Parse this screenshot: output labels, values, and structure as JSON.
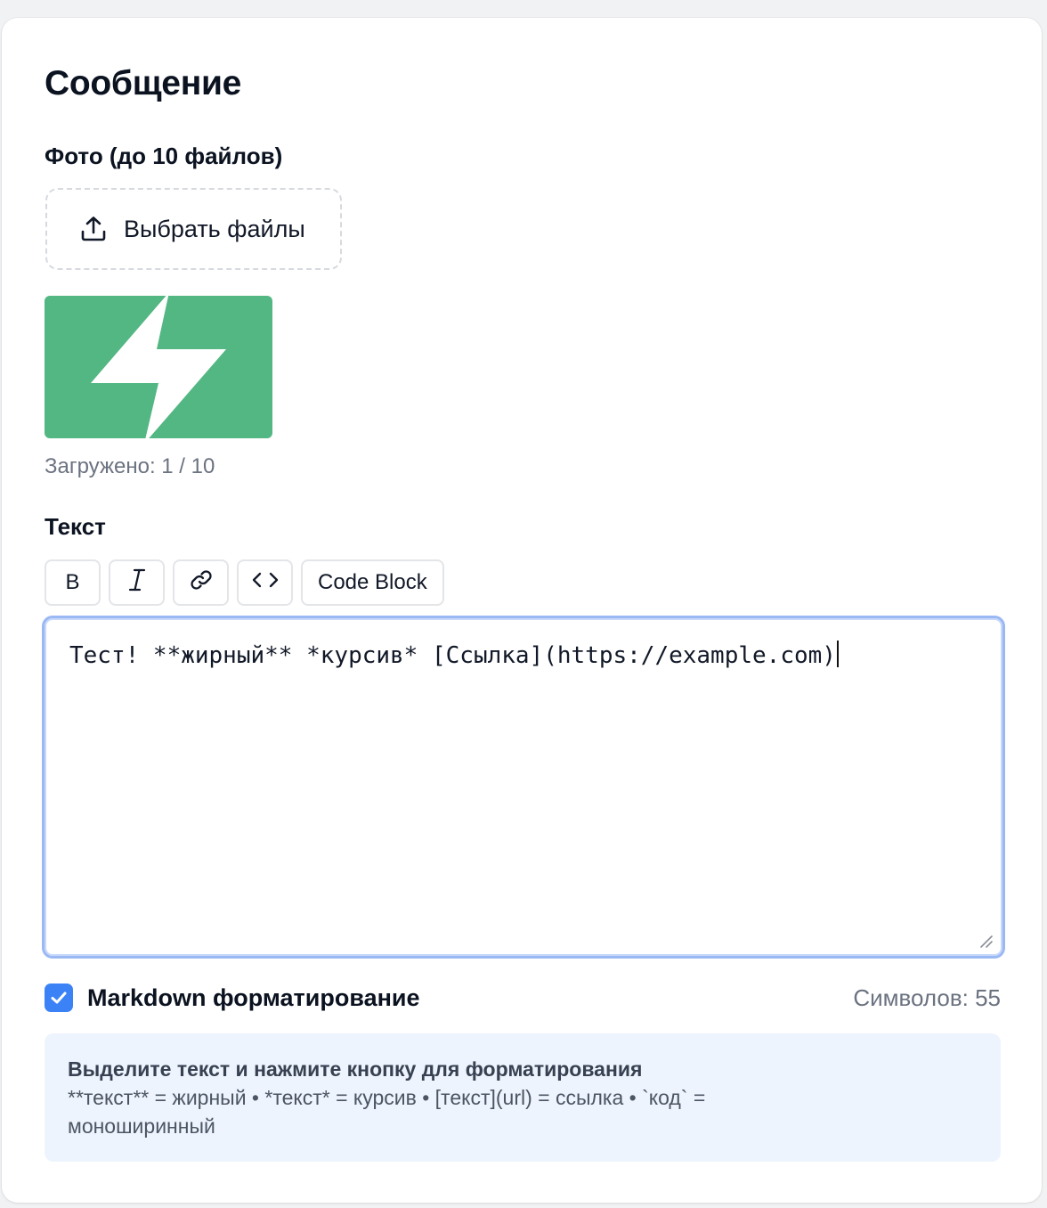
{
  "card": {
    "title": "Сообщение"
  },
  "photos": {
    "label": "Фото (до 10 файлов)",
    "upload_button_label": "Выбрать файлы",
    "upload_icon": "upload-icon",
    "thumbnail_icon": "lightning-bolt-icon",
    "thumbnail_color": "#53b783",
    "uploaded_count_text": "Загружено: 1 / 10"
  },
  "text_section": {
    "label": "Текст",
    "toolbar": {
      "bold_label": "B",
      "italic_label": "I",
      "link_icon": "link-icon",
      "code_icon": "code-icon",
      "code_block_label": "Code Block"
    },
    "editor_value": "Тест! **жирный** *курсив* [Ссылка](https://example.com)"
  },
  "markdown": {
    "checked": true,
    "label": "Markdown форматирование",
    "char_count_text": "Символов: 55"
  },
  "hint": {
    "title": "Выделите текст и нажмите кнопку для форматирования",
    "body": "**текст** = жирный • *текст* = курсив • [текст](url) = ссылка • `код` = моноширинный"
  },
  "colors": {
    "accent": "#3b82f6",
    "focus_ring": "#9ab8f3",
    "hint_background": "#eef4fd"
  }
}
